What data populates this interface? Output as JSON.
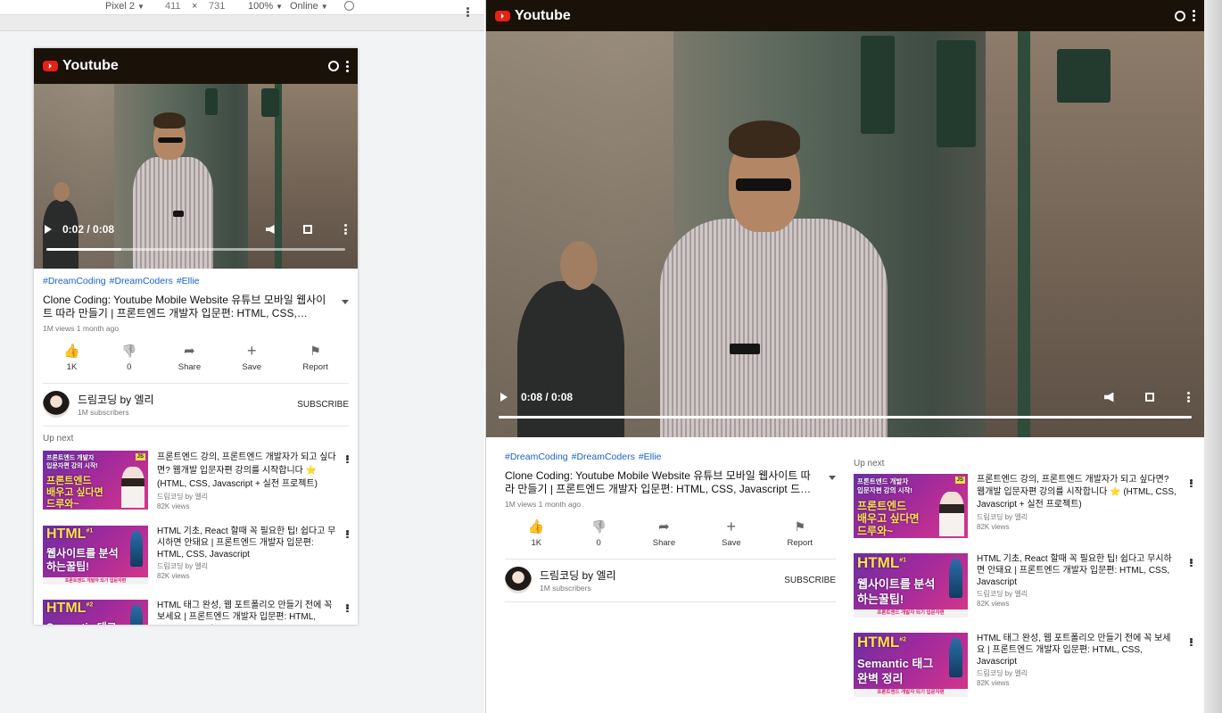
{
  "devtools": {
    "device": "Pixel 2",
    "width": "411",
    "times": "×",
    "height": "731",
    "zoom": "100%",
    "network": "Online"
  },
  "app": {
    "name": "Youtube"
  },
  "video": {
    "time": "0:02 / 0:08",
    "progress": 0.25
  },
  "desktop_video": {
    "time": "0:08 / 0:08",
    "progress": 1.0
  },
  "info": {
    "hashtags": [
      "#DreamCoding",
      "#DreamCoders",
      "#Ellie"
    ],
    "title": "Clone Coding: Youtube Mobile Website 유튜브 모바일 웹사이트 따라 만들기 | 프론트엔드 개발자 입문편: HTML, CSS, Javascript 드림코딩 by 엘리",
    "meta": "1M views 1 month ago"
  },
  "actions": [
    {
      "label": "1K",
      "icon": "thumbs-up-icon"
    },
    {
      "label": "0",
      "icon": "thumbs-down-icon"
    },
    {
      "label": "Share",
      "icon": "share-icon"
    },
    {
      "label": "Save",
      "icon": "plus-icon"
    },
    {
      "label": "Report",
      "icon": "flag-icon"
    }
  ],
  "channel": {
    "name": "드림코딩 by 엘리",
    "subs": "1M subscribers",
    "subscribe": "SUBSCRIBE"
  },
  "upnext": {
    "label": "Up next",
    "items": [
      {
        "title": "프론트엔드 강의, 프론트엔드 개발자가 되고 싶다면? 웹개발 입문자편 강의를 시작합니다 ⭐️ (HTML, CSS, Javascript + 실전 프로젝트)",
        "channel": "드림코딩 by 엘리",
        "views": "82K views",
        "thumb": {
          "line1": "프론트엔드 개발자",
          "line2": "입문자편 강의 시작!",
          "line3": "프론트엔드",
          "line4": "배우고 싶다면",
          "line5": "드루와~",
          "badge": "JS"
        }
      },
      {
        "title": "HTML 기초, React 할때 꼭 필요한 팁! 쉽다고 무시하면 안돼요 | 프론트엔드 개발자 입문편: HTML, CSS, Javascript",
        "channel": "드림코딩 by 엘리",
        "views": "82K views",
        "thumb": {
          "line1": "HTML",
          "num": "#1",
          "line2": "웹사이트를 분석",
          "line3": "하는꿀팁!",
          "badge": "React",
          "banner": "프론트엔드 개발자 되기 입문자편"
        }
      },
      {
        "title": "HTML 태그 완성, 웹 포트폴리오 만들기 전에 꼭 보세요 | 프론트엔드 개발자 입문편: HTML, CSS, Javascript",
        "channel": "드림코딩 by 엘리",
        "views": "82K views",
        "thumb": {
          "line1": "HTML",
          "num": "#2",
          "line2": "Semantic 태그",
          "line3": "완벽 정리",
          "badge": "React",
          "banner": "프론트엔드 개발자 되기 입문자편"
        }
      }
    ]
  }
}
